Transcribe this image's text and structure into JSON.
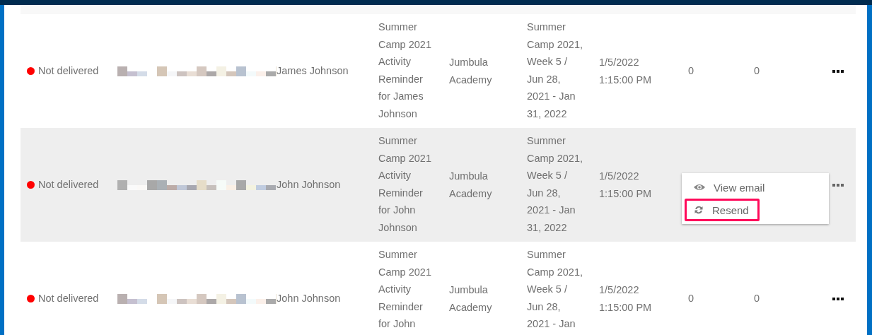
{
  "rows": [
    {
      "status": "Not delivered",
      "recipient": "James Johnson",
      "subject": "Summer Camp 2021 Activity Reminder for James Johnson",
      "organization": "Jumbula Academy",
      "session": "Summer Camp 2021, Week 5 / Jun 28, 2021 - Jan 31, 2022",
      "sent": "1/5/2022 1:15:00 PM",
      "column_8": "0",
      "column_9": "0",
      "selected": false
    },
    {
      "status": "Not delivered",
      "recipient": "John Johnson",
      "subject": "Summer Camp 2021 Activity Reminder for John Johnson",
      "organization": "Jumbula Academy",
      "session": "Summer Camp 2021, Week 5 / Jun 28, 2021 - Jan 31, 2022",
      "sent": "1/5/2022 1:15:00 PM",
      "selected": true,
      "menu": [
        {
          "label": "View email",
          "kind": "view",
          "highlighted": false
        },
        {
          "label": "Resend",
          "kind": "resend",
          "highlighted": true
        }
      ]
    },
    {
      "status": "Not delivered",
      "recipient": "John Johnson",
      "subject": "Summer Camp 2021 Activity Reminder for John",
      "organization": "Jumbula Academy",
      "session": "Summer Camp 2021, Week 5 / Jun 28, 2021 - Jan",
      "sent": "1/5/2022 1:15:00 PM",
      "column_8": "0",
      "column_9": "0",
      "selected": false
    }
  ]
}
